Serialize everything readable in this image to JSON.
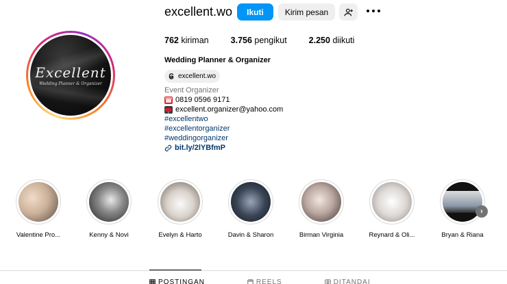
{
  "profile": {
    "username": "excellent.wo",
    "avatar_logo_text": "Excellent",
    "avatar_logo_sub": "Wedding Planner & Organizer",
    "follow_label": "Ikuti",
    "message_label": "Kirim pesan",
    "posts_count": "762",
    "posts_label": "kiriman",
    "followers_count": "3.756",
    "followers_label": "pengikut",
    "following_count": "2.250",
    "following_label": "diikuti",
    "full_name": "Wedding Planner & Organizer",
    "threads_handle": "excellent.wo",
    "category": "Event Organizer",
    "phone": "0819 0596 9171",
    "email": "excellent.organizer@yahoo.com",
    "hashtags": [
      "#excellentwo",
      "#excellentorganizer",
      "#weddingorganizer"
    ],
    "link": "bit.ly/2lYBfmP"
  },
  "highlights": [
    {
      "label": "Valentine Pro...",
      "tone": "#d8c8b8"
    },
    {
      "label": "Kenny & Novi",
      "tone": "#6b6b6b"
    },
    {
      "label": "Evelyn & Harto",
      "tone": "#c9bfb6"
    },
    {
      "label": "Davin & Sharon",
      "tone": "#2f3a4a"
    },
    {
      "label": "Birman Virginia",
      "tone": "#b9aaa3"
    },
    {
      "label": "Reynard & Oli...",
      "tone": "#d6d2cf"
    },
    {
      "label": "Bryan & Riana",
      "tone": "#3a3a3a"
    }
  ],
  "tabs": [
    {
      "label": "POSTINGAN",
      "icon": "grid-icon"
    },
    {
      "label": "REELS",
      "icon": "reels-icon"
    },
    {
      "label": "DITANDAI",
      "icon": "tagged-icon"
    }
  ],
  "colors": {
    "accent": "#0095f6",
    "link": "#00376b",
    "muted": "#737373"
  }
}
